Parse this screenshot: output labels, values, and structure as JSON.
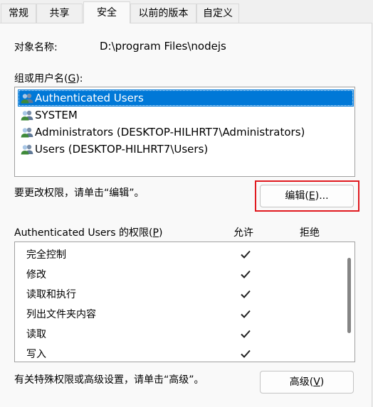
{
  "tabs": [
    {
      "label": "常规"
    },
    {
      "label": "共享"
    },
    {
      "label": "安全",
      "active": true
    },
    {
      "label": "以前的版本"
    },
    {
      "label": "自定义"
    }
  ],
  "object": {
    "label": "对象名称:",
    "value": "D:\\program Files\\nodejs"
  },
  "groups": {
    "label_pre": "组或用户名(",
    "label_key": "G",
    "label_post": "):",
    "users": [
      {
        "name": "Authenticated Users",
        "selected": true,
        "icon": "user-group-icon"
      },
      {
        "name": "SYSTEM",
        "selected": false,
        "icon": "user-group-icon"
      },
      {
        "name": "Administrators (DESKTOP-HILHRT7\\Administrators)",
        "selected": false,
        "icon": "user-group-icon"
      },
      {
        "name": "Users (DESKTOP-HILHRT7\\Users)",
        "selected": false,
        "icon": "user-group-icon"
      }
    ]
  },
  "edit": {
    "hint": "要更改权限，请单击“编辑”。",
    "button_pre": "编辑(",
    "button_key": "E",
    "button_post": ")..."
  },
  "permissions": {
    "title_pre": "Authenticated Users 的权限(",
    "title_key": "P",
    "title_post": ")",
    "allow_header": "允许",
    "deny_header": "拒绝",
    "rows": [
      {
        "name": "完全控制",
        "allow": true,
        "deny": false
      },
      {
        "name": "修改",
        "allow": true,
        "deny": false
      },
      {
        "name": "读取和执行",
        "allow": true,
        "deny": false
      },
      {
        "name": "列出文件夹内容",
        "allow": true,
        "deny": false
      },
      {
        "name": "读取",
        "allow": true,
        "deny": false
      },
      {
        "name": "写入",
        "allow": true,
        "deny": false
      }
    ]
  },
  "advanced": {
    "hint": "有关特殊权限或高级设置，请单击“高级”。",
    "button_pre": "高级(",
    "button_key": "V",
    "button_post": ")"
  },
  "colors": {
    "selection": "#0078d7",
    "highlight_border": "#e0191f",
    "background": "#f0f0f0"
  }
}
